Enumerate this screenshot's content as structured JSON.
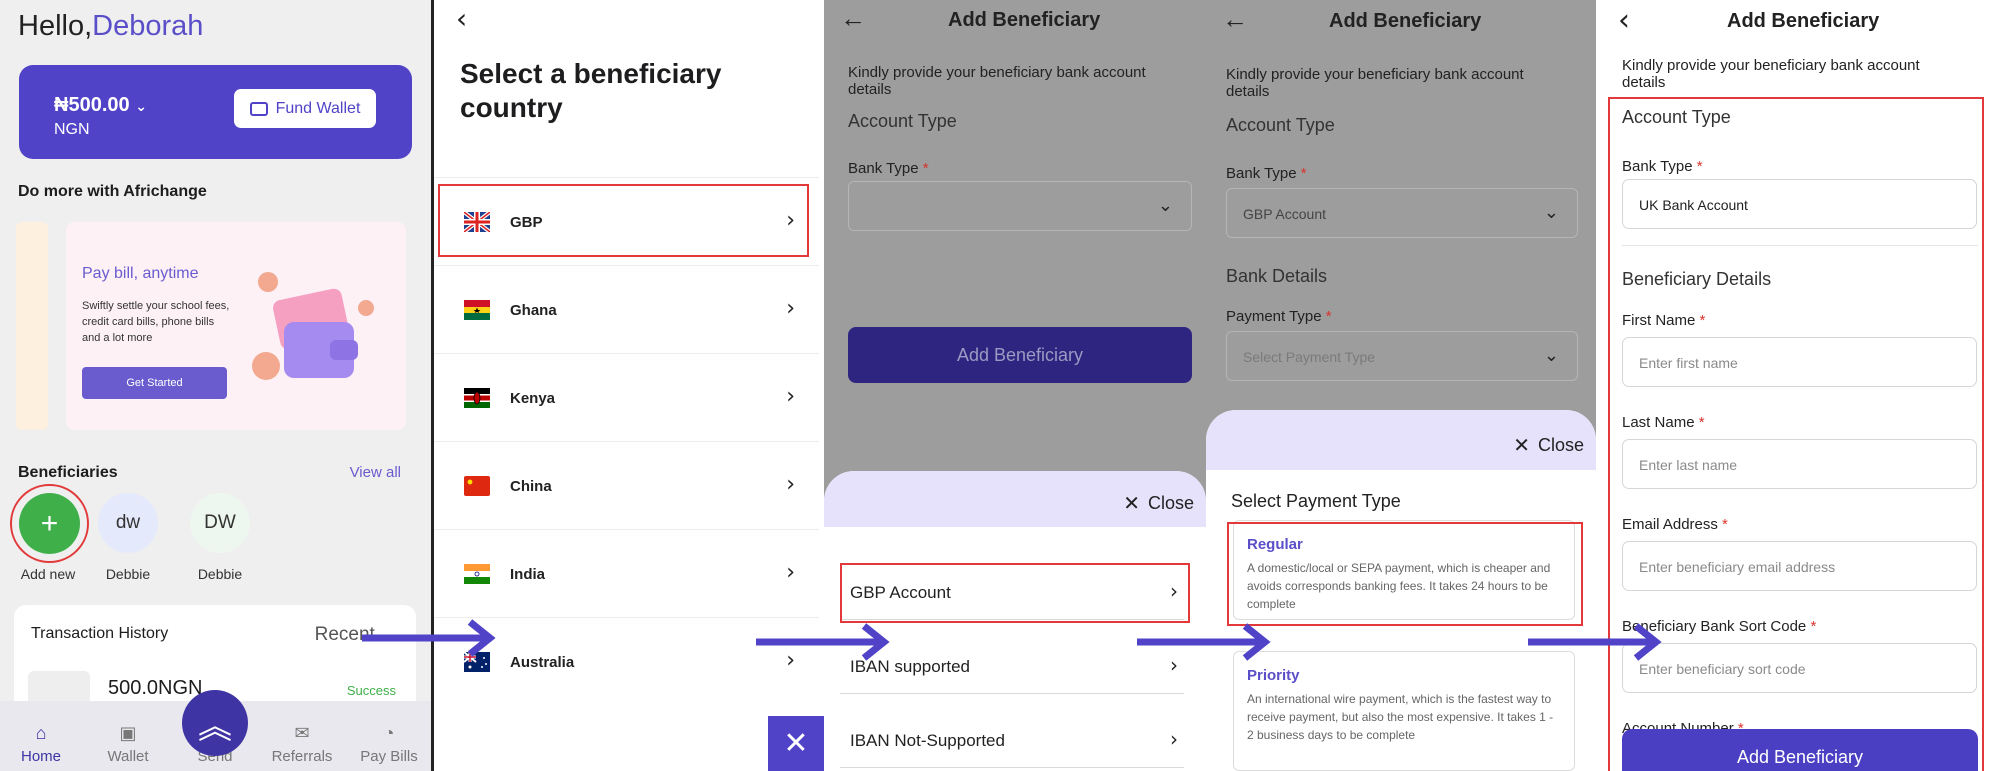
{
  "panel1": {
    "greeting": "Hello,",
    "user_name": "Deborah",
    "wallet": {
      "balance": "₦500.00",
      "currency": "NGN",
      "fund_label": "Fund Wallet"
    },
    "do_more": "Do more with Africhange",
    "promo": {
      "title": "Pay bill, anytime",
      "body": "Swiftly settle your school fees, credit card bills, phone bills and a lot more",
      "cta": "Get Started"
    },
    "beneficiaries": {
      "title": "Beneficiaries",
      "view_all": "View all",
      "add_label": "Add new",
      "items": [
        {
          "initials": "dw",
          "name": "Debbie",
          "bg": "#e4e9fb"
        },
        {
          "initials": "DW",
          "name": "Debbie",
          "bg": "#eef7ef"
        }
      ]
    },
    "transactions": {
      "title": "Transaction History",
      "filter": "Recent",
      "amount": "500.0NGN",
      "status": "Success"
    },
    "nav": [
      "Home",
      "Wallet",
      "Send",
      "Referrals",
      "Pay Bills"
    ]
  },
  "panel2": {
    "title": "Select a beneficiary country",
    "countries": [
      {
        "name": "GBP",
        "flag": "uk-flag"
      },
      {
        "name": "Ghana",
        "flag": "ghana-flag"
      },
      {
        "name": "Kenya",
        "flag": "kenya-flag"
      },
      {
        "name": "China",
        "flag": "china-flag"
      },
      {
        "name": "India",
        "flag": "india-flag"
      },
      {
        "name": "Australia",
        "flag": "australia-flag"
      }
    ]
  },
  "panel3": {
    "title": "Add Beneficiary",
    "subtitle": "Kindly provide your beneficiary bank account details",
    "account_type": "Account Type",
    "bank_type_label": "Bank Type",
    "add_button": "Add Beneficiary",
    "close": "Close",
    "options": [
      "GBP Account",
      "IBAN supported",
      "IBAN Not-Supported"
    ]
  },
  "panel4": {
    "title": "Add Beneficiary",
    "subtitle": "Kindly provide your beneficiary bank account details",
    "account_type": "Account Type",
    "bank_type_label": "Bank Type",
    "bank_type_value": "GBP Account",
    "bank_details": "Bank Details",
    "payment_type_label": "Payment Type",
    "payment_type_placeholder": "Select Payment Type",
    "close": "Close",
    "sheet_title": "Select Payment Type",
    "payment_types": [
      {
        "name": "Regular",
        "desc": "A domestic/local or SEPA payment, which is cheaper and avoids corresponds banking fees. It takes 24 hours to be complete"
      },
      {
        "name": "Priority",
        "desc": "An international wire payment, which is the fastest way to receive payment, but also the most expensive. It takes 1 - 2 business days to be complete"
      }
    ]
  },
  "panel5": {
    "title": "Add Beneficiary",
    "subtitle": "Kindly provide your beneficiary bank account details",
    "account_type": "Account Type",
    "bank_type_label": "Bank Type",
    "bank_type_value": "UK Bank Account",
    "beneficiary_details": "Beneficiary Details",
    "fields": [
      {
        "label": "First Name",
        "placeholder": "Enter first name"
      },
      {
        "label": "Last Name",
        "placeholder": "Enter last name"
      },
      {
        "label": "Email Address",
        "placeholder": "Enter beneficiary email address"
      },
      {
        "label": "Beneficiary Bank Sort Code",
        "placeholder": "Enter beneficiary sort code"
      }
    ],
    "account_number_label": "Account Number",
    "add_button": "Add Beneficiary"
  },
  "colors": {
    "brand": "#5043c7",
    "highlight": "#e23a3a",
    "success": "#3fb049"
  }
}
